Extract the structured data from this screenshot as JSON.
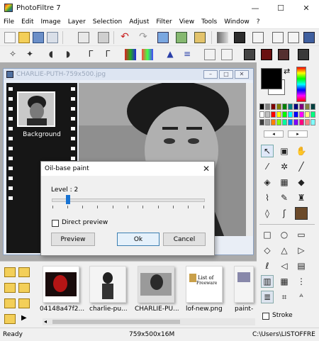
{
  "window": {
    "title": "PhotoFiltre 7",
    "minimize": "—",
    "maximize": "☐",
    "close": "✕"
  },
  "menu": [
    "File",
    "Edit",
    "Image",
    "Layer",
    "Selection",
    "Adjust",
    "Filter",
    "View",
    "Tools",
    "Window",
    "?"
  ],
  "document": {
    "title": "CHARLIE-PUTH-759x500.jpg",
    "layer_label": "Background"
  },
  "dialog": {
    "title": "Oil-base paint",
    "close": "✕",
    "level_label": "Level : 2",
    "level_value": 2,
    "direct_preview_label": "Direct preview",
    "direct_preview_checked": false,
    "preview_button": "Preview",
    "ok_button": "Ok",
    "cancel_button": "Cancel"
  },
  "thumbnails": [
    {
      "label": "04148a47f2...",
      "icon": "photo-red-icon"
    },
    {
      "label": "charlie-pu...",
      "icon": "photo-bw-icon"
    },
    {
      "label": "CHARLIE-PU...",
      "icon": "photo-portrait-icon"
    },
    {
      "label": "lof-new.png",
      "icon": "text-list-icon"
    },
    {
      "label": "paint-",
      "icon": "paint-icon"
    }
  ],
  "thumb_text": {
    "list_line1": "List of",
    "list_line2": "Freeware"
  },
  "right_panel": {
    "stroke_label": "Stroke",
    "stroke_checked": false
  },
  "status": {
    "ready": "Ready",
    "dimensions": "759x500x16M",
    "path": "C:\\Users\\LISTOFFRE"
  },
  "colors": {
    "foreground": "#000000",
    "background": "#ffffff",
    "palette": [
      "#000000",
      "#808080",
      "#800000",
      "#808000",
      "#008000",
      "#008080",
      "#000080",
      "#800080",
      "#808040",
      "#004040",
      "#ffffff",
      "#c0c0c0",
      "#ff0000",
      "#ffff00",
      "#00ff00",
      "#00ffff",
      "#0000ff",
      "#ff00ff",
      "#ffff80",
      "#00ff80",
      "#404040",
      "#a0a0a0",
      "#ff8000",
      "#80ff00",
      "#00ffa0",
      "#0080ff",
      "#8000ff",
      "#ff0080",
      "#ff8080",
      "#80ffff"
    ]
  }
}
